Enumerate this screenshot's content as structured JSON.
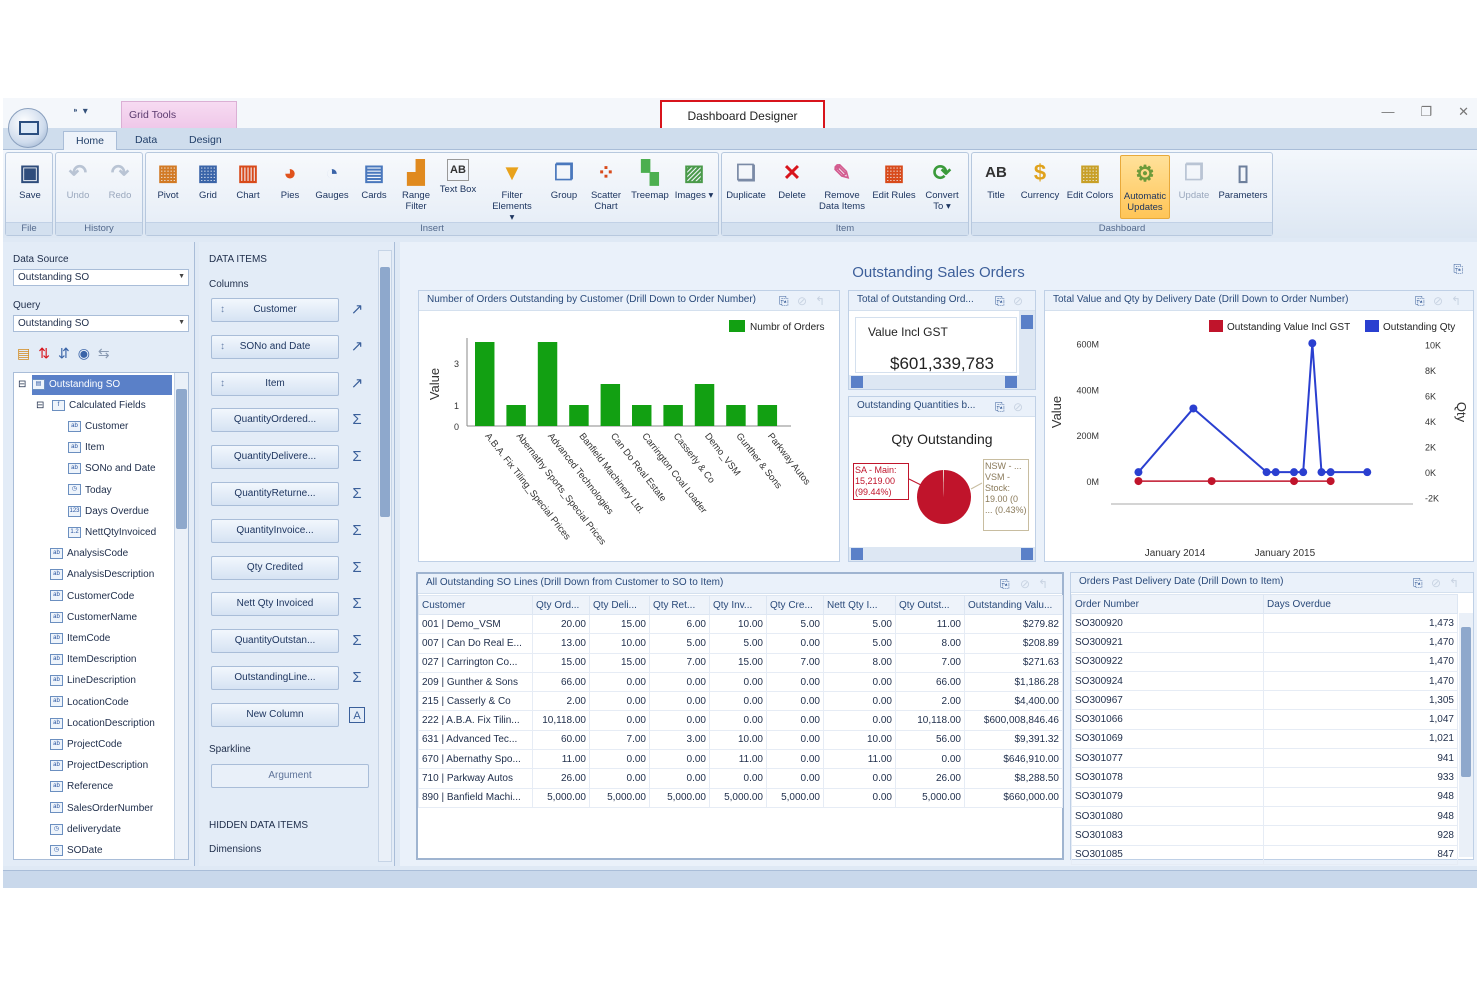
{
  "window": {
    "title": "Dashboard Designer",
    "context_tab": "Grid Tools",
    "qat": "⁍ ▾"
  },
  "tabs": [
    {
      "label": "Home"
    },
    {
      "label": "Data"
    },
    {
      "label": "Design"
    }
  ],
  "ribbon": {
    "groups": [
      {
        "label": "File"
      },
      {
        "label": "History"
      },
      {
        "label": "Insert"
      },
      {
        "label": "Item"
      },
      {
        "label": "Dashboard"
      }
    ],
    "buttons": {
      "save": "Save",
      "undo": "Undo",
      "redo": "Redo",
      "pivot": "Pivot",
      "grid": "Grid",
      "chart": "Chart",
      "pies": "Pies",
      "gauges": "Gauges",
      "cards": "Cards",
      "range_filter": "Range Filter",
      "text_box": "Text Box",
      "filter_elements": "Filter Elements ▾",
      "group": "Group",
      "scatter_chart": "Scatter Chart",
      "treemap": "Treemap",
      "images": "Images ▾",
      "duplicate": "Duplicate",
      "delete": "Delete",
      "remove_data_items": "Remove Data Items",
      "edit_rules": "Edit Rules",
      "convert_to": "Convert To ▾",
      "title": "Title",
      "currency": "Currency",
      "edit_colors": "Edit Colors",
      "automatic_updates": "Automatic Updates",
      "update": "Update",
      "parameters": "Parameters"
    }
  },
  "left": {
    "data_source_label": "Data Source",
    "data_source_value": "Outstanding SO",
    "query_label": "Query",
    "query_value": "Outstanding SO",
    "tree": [
      {
        "label": "Outstanding SO",
        "code": "⊟",
        "icon": "▤"
      },
      {
        "label": "Calculated Fields",
        "code": "⊟",
        "icon": "f"
      },
      {
        "label": "Customer",
        "icon": "ab"
      },
      {
        "label": "Item",
        "icon": "ab"
      },
      {
        "label": "SONo and Date",
        "icon": "ab"
      },
      {
        "label": "Today",
        "icon": "◷"
      },
      {
        "label": "Days Overdue",
        "icon": "123"
      },
      {
        "label": "NettQtyInvoiced",
        "icon": "1.2"
      },
      {
        "label": "AnalysisCode",
        "icon": "ab"
      },
      {
        "label": "AnalysisDescription",
        "icon": "ab"
      },
      {
        "label": "CustomerCode",
        "icon": "ab"
      },
      {
        "label": "CustomerName",
        "icon": "ab"
      },
      {
        "label": "ItemCode",
        "icon": "ab"
      },
      {
        "label": "ItemDescription",
        "icon": "ab"
      },
      {
        "label": "LineDescription",
        "icon": "ab"
      },
      {
        "label": "LocationCode",
        "icon": "ab"
      },
      {
        "label": "LocationDescription",
        "icon": "ab"
      },
      {
        "label": "ProjectCode",
        "icon": "ab"
      },
      {
        "label": "ProjectDescription",
        "icon": "ab"
      },
      {
        "label": "Reference",
        "icon": "ab"
      },
      {
        "label": "SalesOrderNumber",
        "icon": "ab"
      },
      {
        "label": "deliverydate",
        "icon": "◷"
      },
      {
        "label": "SODate",
        "icon": "◷"
      }
    ]
  },
  "data_items": {
    "header": "DATA ITEMS",
    "columns_label": "Columns",
    "items": [
      {
        "label": "Customer",
        "marker": "↕",
        "agg": "↗"
      },
      {
        "label": "SONo and Date",
        "marker": "↕",
        "agg": "↗"
      },
      {
        "label": "Item",
        "marker": "↕",
        "agg": "↗"
      },
      {
        "label": "QuantityOrdered...",
        "marker": "",
        "agg": "Σ"
      },
      {
        "label": "QuantityDelivere...",
        "marker": "",
        "agg": "Σ"
      },
      {
        "label": "QuantityReturne...",
        "marker": "",
        "agg": "Σ"
      },
      {
        "label": "QuantityInvoice...",
        "marker": "",
        "agg": "Σ"
      },
      {
        "label": "Qty Credited",
        "marker": "",
        "agg": "Σ"
      },
      {
        "label": "Nett Qty Invoiced",
        "marker": "",
        "agg": "Σ"
      },
      {
        "label": "QuantityOutstan...",
        "marker": "",
        "agg": "Σ"
      },
      {
        "label": "OutstandingLine...",
        "marker": "",
        "agg": "Σ"
      },
      {
        "label": "New Column",
        "marker": "",
        "agg": "A"
      }
    ],
    "sparkline_label": "Sparkline",
    "argument_label": "Argument",
    "hidden_header": "HIDDEN DATA ITEMS",
    "dimensions_label": "Dimensions"
  },
  "dashboard": {
    "title": "Outstanding Sales Orders",
    "bar_panel": {
      "title": "Number of Orders Outstanding by Customer (Drill Down to Order Number)"
    },
    "card_panel": {
      "title": "Total of Outstanding Ord...",
      "label": "Value Incl GST",
      "value": "$601,339,783"
    },
    "pie_panel": {
      "title": "Outstanding Quantities b...",
      "chart_title": "Qty Outstanding",
      "label_left": "SA - Main: 15,219.00 (99.44%)",
      "label_right": "NSW - ... VSM - Stock: 19.00 (0 ... (0.43%)"
    },
    "line_panel": {
      "title": "Total Value and Qty by Delivery Date (Drill Down to Order Number)"
    },
    "grid_panel": {
      "title": "All Outstanding SO Lines (Drill Down from Customer to SO to Item)",
      "columns": [
        "Customer",
        "Qty Ord...",
        "Qty Deli...",
        "Qty Ret...",
        "Qty Inv...",
        "Qty Cre...",
        "Nett Qty I...",
        "Qty Outst...",
        "Outstanding Valu..."
      ],
      "rows": [
        [
          "001 | Demo_VSM",
          "20.00",
          "15.00",
          "6.00",
          "10.00",
          "5.00",
          "5.00",
          "11.00",
          "$279.82"
        ],
        [
          "007 | Can Do Real E...",
          "13.00",
          "10.00",
          "5.00",
          "5.00",
          "0.00",
          "5.00",
          "8.00",
          "$208.89"
        ],
        [
          "027 | Carrington Co...",
          "15.00",
          "15.00",
          "7.00",
          "15.00",
          "7.00",
          "8.00",
          "7.00",
          "$271.63"
        ],
        [
          "209 | Gunther & Sons",
          "66.00",
          "0.00",
          "0.00",
          "0.00",
          "0.00",
          "0.00",
          "66.00",
          "$1,186.28"
        ],
        [
          "215 | Casserly & Co",
          "2.00",
          "0.00",
          "0.00",
          "0.00",
          "0.00",
          "0.00",
          "2.00",
          "$4,400.00"
        ],
        [
          "222 | A.B.A. Fix Tilin...",
          "10,118.00",
          "0.00",
          "0.00",
          "0.00",
          "0.00",
          "0.00",
          "10,118.00",
          "$600,008,846.46"
        ],
        [
          "631 | Advanced Tec...",
          "60.00",
          "7.00",
          "3.00",
          "10.00",
          "0.00",
          "10.00",
          "56.00",
          "$9,391.32"
        ],
        [
          "670 | Abernathy Spo...",
          "11.00",
          "0.00",
          "0.00",
          "11.00",
          "0.00",
          "11.00",
          "0.00",
          "$646,910.00"
        ],
        [
          "710 | Parkway Autos",
          "26.00",
          "0.00",
          "0.00",
          "0.00",
          "0.00",
          "0.00",
          "26.00",
          "$8,288.50"
        ],
        [
          "890 | Banfield Machi...",
          "5,000.00",
          "5,000.00",
          "5,000.00",
          "5,000.00",
          "5,000.00",
          "0.00",
          "5,000.00",
          "$660,000.00"
        ]
      ]
    },
    "overdue_panel": {
      "title": "Orders Past Delivery Date (Drill Down to Item)",
      "columns": [
        "Order Number",
        "Days Overdue"
      ],
      "rows": [
        [
          "SO300920",
          "1,473"
        ],
        [
          "SO300921",
          "1,470"
        ],
        [
          "SO300922",
          "1,470"
        ],
        [
          "SO300924",
          "1,470"
        ],
        [
          "SO300967",
          "1,305"
        ],
        [
          "SO301066",
          "1,047"
        ],
        [
          "SO301069",
          "1,021"
        ],
        [
          "SO301077",
          "941"
        ],
        [
          "SO301078",
          "933"
        ],
        [
          "SO301079",
          "948"
        ],
        [
          "SO301080",
          "948"
        ],
        [
          "SO301083",
          "928"
        ],
        [
          "SO301085",
          "847"
        ]
      ]
    }
  },
  "chart_data": [
    {
      "type": "bar",
      "title": "",
      "ylabel": "Value",
      "legend": "top-right",
      "categories": [
        "A.B.A. Fix Tiling_Special Prices",
        "Abernathy Sports_Special Prices",
        "Advanced Technologies",
        "Banfield Machinery Ltd.",
        "Can Do Real Estate",
        "Carrington Coal Loader",
        "Casserly & Co",
        "Demo_VSM",
        "Gunther & Sons",
        "Parkway Autos"
      ],
      "series": [
        {
          "name": "Numbr of Orders",
          "values": [
            4,
            1,
            4,
            1,
            2,
            1,
            1,
            2,
            1,
            1
          ],
          "color": "#12a012"
        }
      ],
      "ylim": [
        0,
        4
      ],
      "yticks": [
        0,
        1,
        3
      ]
    },
    {
      "type": "pie",
      "title": "Qty Outstanding",
      "series": [
        {
          "values": [
            99.44,
            0.13,
            0.43
          ],
          "colors": [
            "#c0142b",
            "#d9d9d9",
            "#e8dcc8"
          ]
        }
      ]
    },
    {
      "type": "line",
      "title": "",
      "ylabel": "Value",
      "y2label": "Qty",
      "legend": "top-right",
      "xlabels": [
        "January 2014",
        "January 2015"
      ],
      "xlim": [
        "2013-06",
        "2016-03"
      ],
      "ylim": [
        -100,
        650
      ],
      "yticks": [
        "0M",
        "200M",
        "400M",
        "600M"
      ],
      "y2lim": [
        -2500,
        11000
      ],
      "y2ticks": [
        "-2K",
        "0K",
        "2K",
        "4K",
        "6K",
        "8K",
        "10K"
      ],
      "series": [
        {
          "name": "Outstanding Value Incl GST",
          "color": "#c0142b",
          "points": [
            [
              "2013-09",
              0
            ],
            [
              "2014-05",
              0
            ],
            [
              "2015-02",
              0
            ],
            [
              "2015-06",
              0
            ]
          ]
        },
        {
          "name": "Outstanding Qty",
          "color": "#2a3fd0",
          "points": [
            [
              "2013-09",
              0
            ],
            [
              "2014-03",
              5000
            ],
            [
              "2014-11",
              0
            ],
            [
              "2014-12",
              0
            ],
            [
              "2015-02",
              0
            ],
            [
              "2015-03",
              0
            ],
            [
              "2015-04",
              10118
            ],
            [
              "2015-05",
              0
            ],
            [
              "2015-06",
              0
            ],
            [
              "2015-10",
              0
            ]
          ]
        }
      ]
    }
  ]
}
